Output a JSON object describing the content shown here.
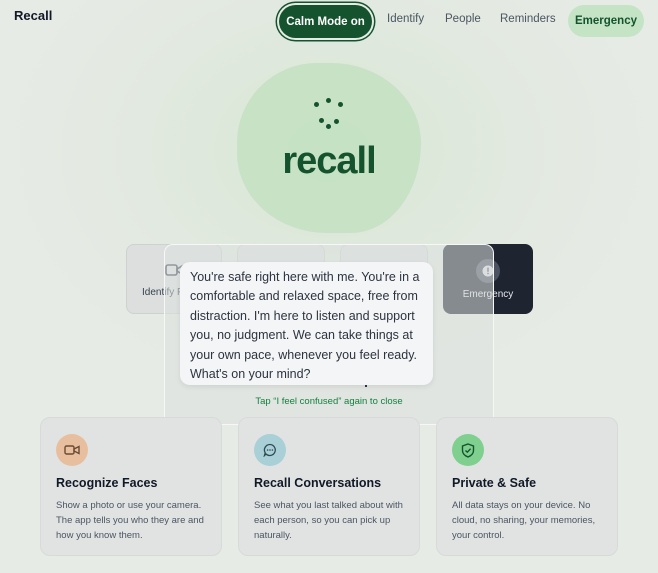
{
  "brand": "Recall",
  "nav": {
    "calm_mode": "Calm Mode on",
    "identify": "Identify",
    "people": "People",
    "reminders": "Reminders",
    "emergency": "Emergency"
  },
  "hero": {
    "title": "recall"
  },
  "actions": {
    "identify_partial": "Identify P",
    "emergency": "Emergency"
  },
  "overlay": {
    "message": "You're safe right here with me. You're in a comfortable and relaxed space, free from distraction. I'm here to listen and support you, no judgment. We can take things at your own pace, whenever you feel ready. What's on your mind?",
    "close_hint": "Tap “I feel confused” again to close"
  },
  "features": [
    {
      "title": "Recognize Faces",
      "desc": "Show a photo or use your camera. The app tells you who they are and how you know them.",
      "icon": "video-camera-icon",
      "color": "#e7bf9f"
    },
    {
      "title": "Recall Conversations",
      "desc": "See what you last talked about with each person, so you can pick up naturally.",
      "icon": "chat-bubble-icon",
      "color": "#a9cfd7"
    },
    {
      "title": "Private & Safe",
      "desc": "All data stays on your device. No cloud, no sharing, your memories, your control.",
      "icon": "shield-check-icon",
      "color": "#7fd08f"
    }
  ]
}
